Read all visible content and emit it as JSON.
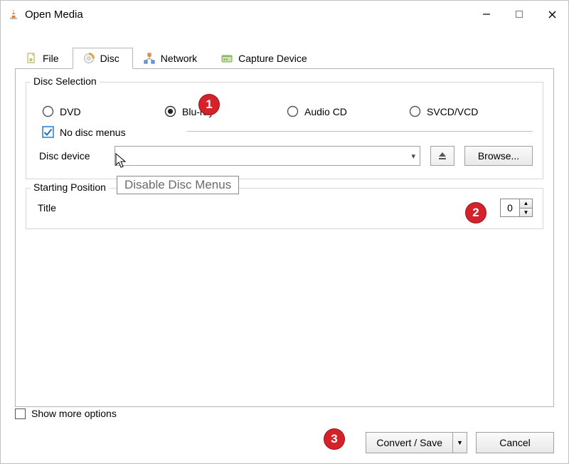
{
  "window": {
    "title": "Open Media"
  },
  "tabs": {
    "file": "File",
    "disc": "Disc",
    "network": "Network",
    "capture": "Capture Device",
    "active": "disc"
  },
  "disc_selection": {
    "group_label": "Disc Selection",
    "options": {
      "dvd": "DVD",
      "bluray": "Blu-ray",
      "audiocd": "Audio CD",
      "svcd": "SVCD/VCD"
    },
    "selected": "bluray",
    "no_disc_menus_label": "No disc menus",
    "no_disc_menus_checked": true,
    "tooltip": "Disable Disc Menus",
    "device_label": "Disc device",
    "device_value": "",
    "browse_label": "Browse..."
  },
  "starting_position": {
    "group_label": "Starting Position",
    "title_label": "Title",
    "title_value": "0"
  },
  "footer": {
    "show_more_label": "Show more options",
    "show_more_checked": false,
    "convert_label": "Convert / Save",
    "cancel_label": "Cancel"
  },
  "annotations": {
    "m1": "1",
    "m2": "2",
    "m3": "3"
  }
}
